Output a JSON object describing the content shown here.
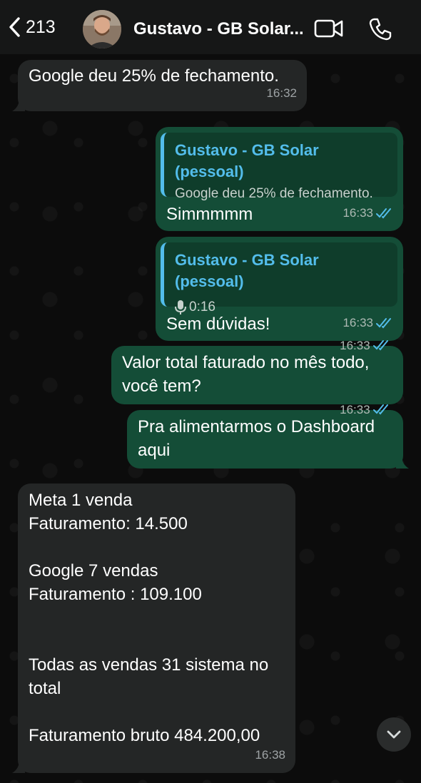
{
  "header": {
    "back_count": "213",
    "contact_name": "Gustavo - GB Solar...",
    "icons": [
      "chevron-left-icon",
      "video-camera-icon",
      "phone-icon"
    ]
  },
  "messages": [
    {
      "direction": "incoming",
      "text": "Google deu 25% de fechamento.",
      "time": "16:32"
    },
    {
      "direction": "outgoing",
      "quote_author": "Gustavo - GB Solar (pessoal)",
      "quote_text": "Google deu 25% de fechamento.",
      "text": "Simmmmm",
      "time": "16:33",
      "status": "read"
    },
    {
      "direction": "outgoing",
      "quote_author": "Gustavo - GB Solar (pessoal)",
      "quote_voice_duration": "0:16",
      "text": "Sem dúvidas!",
      "time": "16:33",
      "status": "read"
    },
    {
      "direction": "outgoing",
      "lines": [
        "Valor total faturado no mês todo,",
        "você tem?"
      ],
      "time": "16:33",
      "status": "read"
    },
    {
      "direction": "outgoing",
      "lines": [
        "Pra alimentarmos o Dashboard",
        "aqui"
      ],
      "time": "16:33",
      "status": "read"
    },
    {
      "direction": "incoming",
      "lines": [
        "Meta 1 venda",
        "Faturamento: 14.500",
        "",
        "Google 7 vendas",
        "Faturamento : 109.100",
        "",
        "",
        "Todas as vendas 31 sistema no",
        "total",
        "",
        "Faturamento bruto 484.200,00"
      ],
      "time": "16:38"
    }
  ],
  "colors": {
    "header_bg": "#161717",
    "incoming_bubble": "#242626",
    "outgoing_bubble": "#144d37",
    "quote_accent": "#53bdeb",
    "read_ticks": "#53bdeb"
  }
}
